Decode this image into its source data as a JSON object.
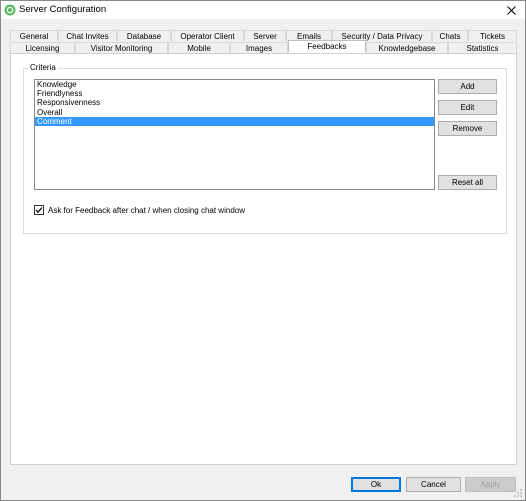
{
  "window": {
    "title": "Server Configuration"
  },
  "tabs_row1": [
    {
      "label": "General"
    },
    {
      "label": "Chat Invites"
    },
    {
      "label": "Database"
    },
    {
      "label": "Operator Client"
    },
    {
      "label": "Server"
    },
    {
      "label": "Emails"
    },
    {
      "label": "Security / Data Privacy"
    },
    {
      "label": "Chats"
    },
    {
      "label": "Tickets"
    }
  ],
  "tabs_row2": [
    {
      "label": "Licensing"
    },
    {
      "label": "Visitor Monitoring"
    },
    {
      "label": "Mobile"
    },
    {
      "label": "Images"
    },
    {
      "label": "Feedbacks",
      "active": true
    },
    {
      "label": "Knowledgebase"
    },
    {
      "label": "Statistics"
    }
  ],
  "criteria": {
    "legend": "Criteria",
    "items": [
      {
        "label": "Knowledge"
      },
      {
        "label": "Friendlyness"
      },
      {
        "label": "Responsivenness"
      },
      {
        "label": "Overall"
      },
      {
        "label": "Comment",
        "selected": true
      }
    ],
    "add_label": "Add",
    "edit_label": "Edit",
    "remove_label": "Remove",
    "reset_label": "Reset all",
    "ask_feedback_label": "Ask for Feedback after chat / when closing chat window",
    "ask_feedback_checked": true
  },
  "footer": {
    "ok_label": "Ok",
    "cancel_label": "Cancel",
    "apply_label": "Apply"
  },
  "colors": {
    "selection": "#3399ff",
    "accent": "#0078d7",
    "icon_green": "#5cb85c"
  }
}
